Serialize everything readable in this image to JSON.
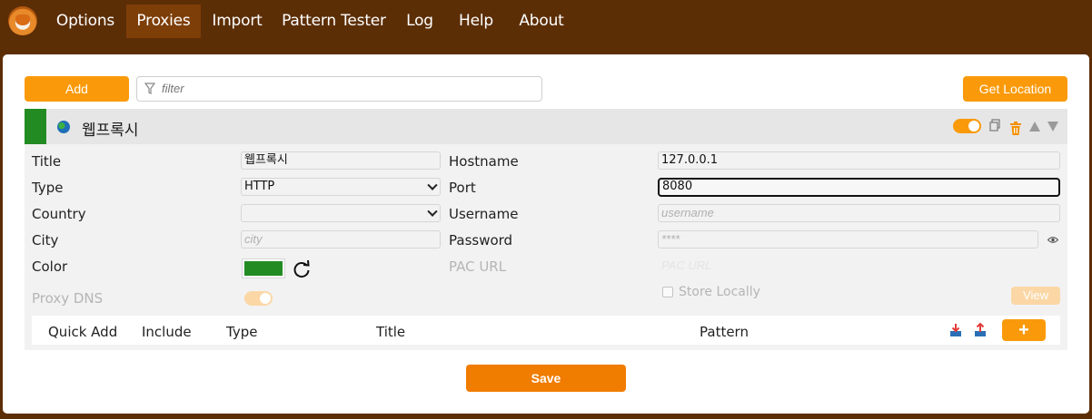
{
  "nav": {
    "tabs": [
      {
        "label": "Options",
        "active": false
      },
      {
        "label": "Proxies",
        "active": true
      },
      {
        "label": "Import",
        "active": false
      },
      {
        "label": "Pattern Tester",
        "active": false
      },
      {
        "label": "Log",
        "active": false
      },
      {
        "label": "Help",
        "active": false
      },
      {
        "label": "About",
        "active": false
      }
    ]
  },
  "toolbar": {
    "add_label": "Add",
    "filter_placeholder": "filter",
    "get_location_label": "Get Location"
  },
  "proxy": {
    "name": "웹프록시",
    "color": "#228b22",
    "enabled": true,
    "fields": {
      "title_label": "Title",
      "title_value": "웹프록시",
      "type_label": "Type",
      "type_value": "HTTP",
      "country_label": "Country",
      "country_value": "",
      "city_label": "City",
      "city_placeholder": "city",
      "color_label": "Color",
      "proxy_dns_label": "Proxy DNS",
      "hostname_label": "Hostname",
      "hostname_value": "127.0.0.1",
      "port_label": "Port",
      "port_value": "8080",
      "username_label": "Username",
      "username_placeholder": "username",
      "password_label": "Password",
      "password_placeholder": "****",
      "pac_url_label": "PAC URL",
      "pac_url_placeholder": "PAC URL",
      "store_locally_label": "Store Locally",
      "view_label": "View"
    }
  },
  "patterns": {
    "headers": [
      "Quick Add",
      "Include",
      "Type",
      "Title",
      "Pattern"
    ],
    "add_label": "+"
  },
  "footer": {
    "save_label": "Save"
  },
  "colors": {
    "brand_brown": "#5c2e06",
    "active_tab": "#7e3e08",
    "accent_orange": "#fa9a0a",
    "save_orange": "#f07c00"
  }
}
